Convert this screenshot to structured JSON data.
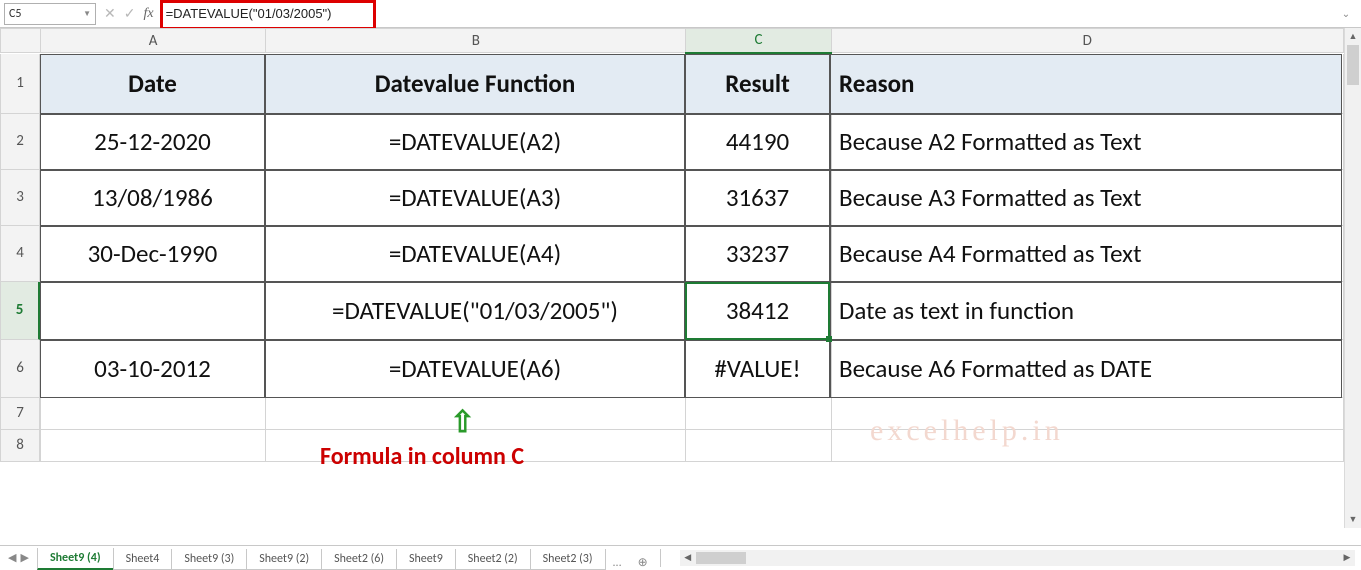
{
  "namebox": "C5",
  "formula": "=DATEVALUE(\"01/03/2005\")",
  "columns": [
    "A",
    "B",
    "C",
    "D"
  ],
  "selectedCol": "C",
  "rowHeaders": [
    "1",
    "2",
    "3",
    "4",
    "5",
    "6",
    "7",
    "8"
  ],
  "selectedRow": "5",
  "header": {
    "A": "Date",
    "B": "Datevalue Function",
    "C": "Result",
    "D": "Reason"
  },
  "data": [
    {
      "A": "25-12-2020",
      "B": "=DATEVALUE(A2)",
      "C": "44190",
      "D": "Because A2 Formatted as Text"
    },
    {
      "A": "13/08/1986",
      "B": "=DATEVALUE(A3)",
      "C": "31637",
      "D": "Because A3 Formatted as Text"
    },
    {
      "A": "30-Dec-1990",
      "B": "=DATEVALUE(A4)",
      "C": "33237",
      "D": "Because A4 Formatted as Text"
    },
    {
      "A": "",
      "B": "=DATEVALUE(\"01/03/2005\")",
      "C": "38412",
      "D": " Date as text in function"
    },
    {
      "A": "03-10-2012",
      "B": "=DATEVALUE(A6)",
      "C": "#VALUE!",
      "D": "Because A6 Formatted as DATE"
    }
  ],
  "annotation": "Formula in column C",
  "watermark": "excelhelp.in",
  "tabs": [
    "Sheet9 (4)",
    "Sheet4",
    "Sheet9 (3)",
    "Sheet9 (2)",
    "Sheet2 (6)",
    "Sheet9",
    "Sheet2 (2)",
    "Sheet2 (3)"
  ],
  "activeTab": "Sheet9 (4)",
  "tabMore": "...",
  "colWidths": {
    "row": 40,
    "A": 225,
    "B": 420,
    "C": 145,
    "D": 512
  },
  "rowHeights": {
    "hdr": 24,
    "1": 60,
    "2": 56,
    "3": 56,
    "4": 56,
    "5": 58,
    "6": 58,
    "7": 32,
    "8": 32
  }
}
